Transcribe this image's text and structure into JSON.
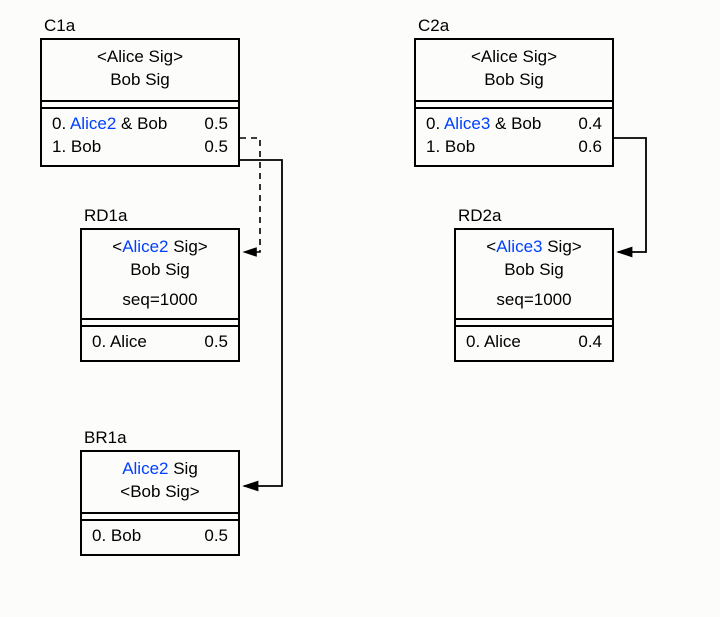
{
  "boxes": {
    "c1a": {
      "label": "C1a",
      "sig_top_pre": "<",
      "sig_top_name": "Alice",
      "sig_top_post": " Sig>",
      "sig_bot": "Bob Sig",
      "out0_idx": "0. ",
      "out0_key_blue": "Alice2",
      "out0_rest": " & Bob",
      "out0_val": "0.5",
      "out1_left": "1. Bob",
      "out1_val": "0.5"
    },
    "c2a": {
      "label": "C2a",
      "sig_top_pre": "<",
      "sig_top_name": "Alice",
      "sig_top_post": " Sig>",
      "sig_bot": "Bob Sig",
      "out0_idx": "0. ",
      "out0_key_blue": "Alice3",
      "out0_rest": " & Bob",
      "out0_val": "0.4",
      "out1_left": "1. Bob",
      "out1_val": "0.6"
    },
    "rd1a": {
      "label": "RD1a",
      "sig_top_pre": "<",
      "sig_top_name": "Alice2",
      "sig_top_post": " Sig>",
      "sig_bot": "Bob Sig",
      "seq": "seq=1000",
      "out0_left": "0. Alice",
      "out0_val": "0.5"
    },
    "rd2a": {
      "label": "RD2a",
      "sig_top_pre": "<",
      "sig_top_name": "Alice3",
      "sig_top_post": " Sig>",
      "sig_bot": "Bob Sig",
      "seq": "seq=1000",
      "out0_left": "0. Alice",
      "out0_val": "0.4"
    },
    "br1a": {
      "label": "BR1a",
      "sig_top_name": "Alice2",
      "sig_top_post": " Sig",
      "sig_bot_pre": "<",
      "sig_bot_name": "Bob Sig",
      "sig_bot_post": ">",
      "out0_left": "0. Bob",
      "out0_val": "0.5"
    }
  }
}
